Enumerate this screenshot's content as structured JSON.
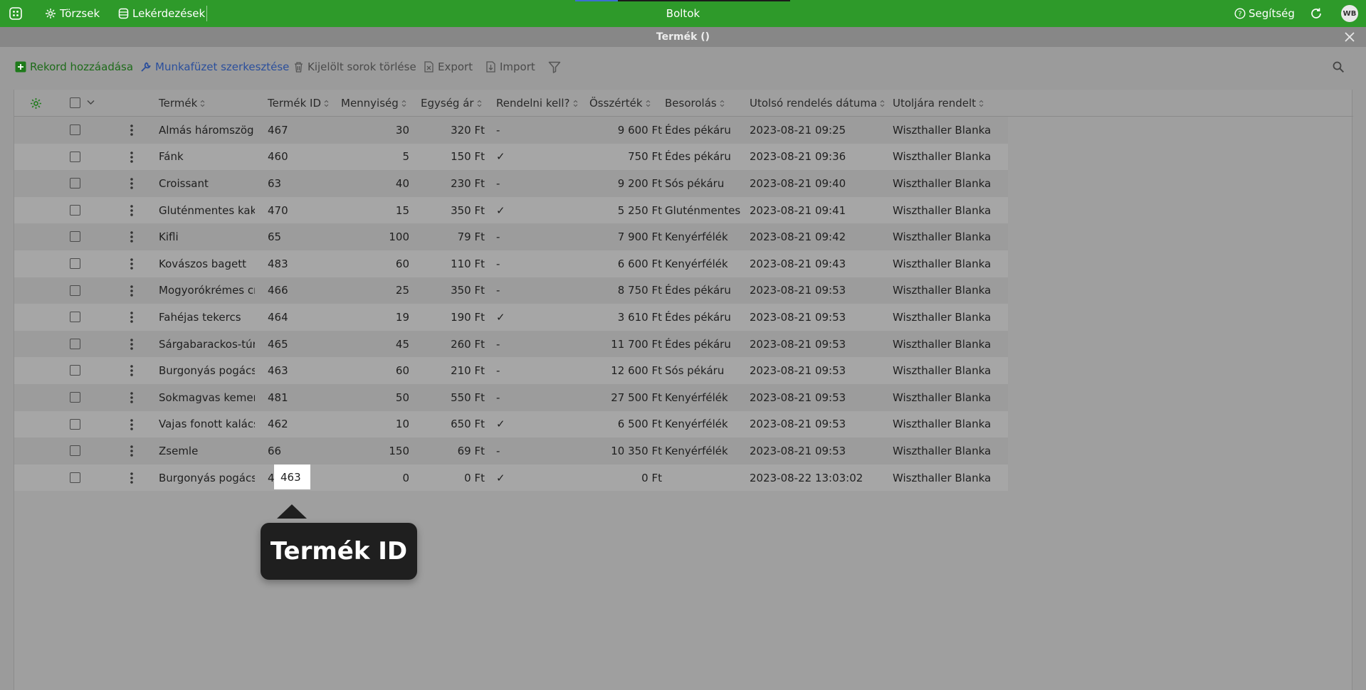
{
  "topbar": {
    "nav_items": [
      {
        "label": "Törzsek",
        "icon": "tree-icon"
      },
      {
        "label": "Lekérdezések",
        "icon": "database-icon"
      }
    ],
    "title": "Boltok",
    "help_label": "Segítség",
    "avatar_initials": "WB",
    "accent_color": "#2e9a2a"
  },
  "modal": {
    "title": "Termék ()"
  },
  "toolbar": {
    "add_record": "Rekord hozzáadása",
    "edit_workbook": "Munkafüzet szerkesztése",
    "delete_selected": "Kijelölt sorok törlése",
    "export": "Export",
    "import": "Import"
  },
  "table": {
    "columns": [
      "Termék",
      "Termék ID",
      "Mennyiség",
      "Egység ár",
      "Rendelni kell?",
      "Összérték",
      "Besorolás",
      "Utolsó rendelés dátuma",
      "Utoljára rendelt"
    ],
    "rows": [
      [
        "Almás háromszög",
        "467",
        "30",
        "320 Ft",
        "-",
        "9 600 Ft",
        "Édes pékáru",
        "2023-08-21 09:25",
        "Wiszthaller Blanka"
      ],
      [
        "Fánk",
        "460",
        "5",
        "150 Ft",
        "✓",
        "750 Ft",
        "Édes pékáru",
        "2023-08-21 09:36",
        "Wiszthaller Blanka"
      ],
      [
        "Croissant",
        "63",
        "40",
        "230 Ft",
        "-",
        "9 200 Ft",
        "Sós pékáru",
        "2023-08-21 09:40",
        "Wiszthaller Blanka"
      ],
      [
        "Gluténmentes kaka",
        "470",
        "15",
        "350 Ft",
        "✓",
        "5 250 Ft",
        "Gluténmentes",
        "2023-08-21 09:41",
        "Wiszthaller Blanka"
      ],
      [
        "Kifli",
        "65",
        "100",
        "79 Ft",
        "-",
        "7 900 Ft",
        "Kenyérfélék",
        "2023-08-21 09:42",
        "Wiszthaller Blanka"
      ],
      [
        "Kovászos bagett",
        "483",
        "60",
        "110 Ft",
        "-",
        "6 600 Ft",
        "Kenyérfélék",
        "2023-08-21 09:43",
        "Wiszthaller Blanka"
      ],
      [
        "Mogyorókrémes cro",
        "466",
        "25",
        "350 Ft",
        "-",
        "8 750 Ft",
        "Édes pékáru",
        "2023-08-21 09:53",
        "Wiszthaller Blanka"
      ],
      [
        "Fahéjas tekercs",
        "464",
        "19",
        "190 Ft",
        "✓",
        "3 610 Ft",
        "Édes pékáru",
        "2023-08-21 09:53",
        "Wiszthaller Blanka"
      ],
      [
        "Sárgabarackos-túró",
        "465",
        "45",
        "260 Ft",
        "-",
        "11 700 Ft",
        "Édes pékáru",
        "2023-08-21 09:53",
        "Wiszthaller Blanka"
      ],
      [
        "Burgonyás pogácsa",
        "463",
        "60",
        "210 Ft",
        "-",
        "12 600 Ft",
        "Sós pékáru",
        "2023-08-21 09:53",
        "Wiszthaller Blanka"
      ],
      [
        "Sokmagvas kemenc",
        "481",
        "50",
        "550 Ft",
        "-",
        "27 500 Ft",
        "Kenyérfélék",
        "2023-08-21 09:53",
        "Wiszthaller Blanka"
      ],
      [
        "Vajas fonott kalács",
        "462",
        "10",
        "650 Ft",
        "✓",
        "6 500 Ft",
        "Kenyérfélék",
        "2023-08-21 09:53",
        "Wiszthaller Blanka"
      ],
      [
        "Zsemle",
        "66",
        "150",
        "69 Ft",
        "-",
        "10 350 Ft",
        "Kenyérfélék",
        "2023-08-21 09:53",
        "Wiszthaller Blanka"
      ],
      [
        "Burgonyás pogácsa",
        "463",
        "0",
        "0 Ft",
        "✓",
        "0 Ft",
        "",
        "2023-08-22 13:03:02",
        "Wiszthaller Blanka"
      ]
    ]
  },
  "tooltip": {
    "text": "Termék ID"
  }
}
